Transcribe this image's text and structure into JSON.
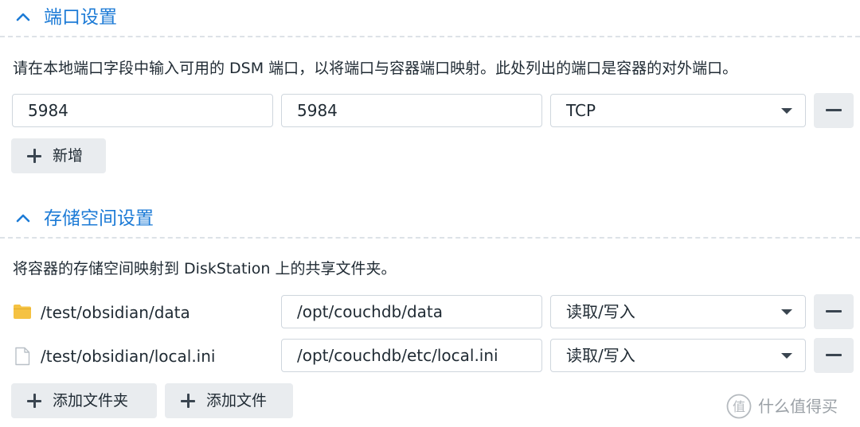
{
  "port_section": {
    "title": "端口设置",
    "description": "请在本地端口字段中输入可用的 DSM 端口，以将端口与容器端口映射。此处列出的端口是容器的对外端口。",
    "rows": [
      {
        "local_port": "5984",
        "container_port": "5984",
        "protocol": "TCP"
      }
    ],
    "add_label": "新增"
  },
  "storage_section": {
    "title": "存储空间设置",
    "description": "将容器的存储空间映射到 DiskStation 上的共享文件夹。",
    "rows": [
      {
        "icon": "folder-icon",
        "host_path": "/test/obsidian/data",
        "mount_path": "/opt/couchdb/data",
        "permission": "读取/写入"
      },
      {
        "icon": "file-icon",
        "host_path": "/test/obsidian/local.ini",
        "mount_path": "/opt/couchdb/etc/local.ini",
        "permission": "读取/写入"
      }
    ],
    "add_folder_label": "添加文件夹",
    "add_file_label": "添加文件"
  },
  "watermark": {
    "text": "什么值得买",
    "icon": "watermark-logo-icon"
  },
  "colors": {
    "accent": "#1d7bd6",
    "button_bg": "#e9ecef",
    "border": "#cfd6dd",
    "folder": "#f5c242"
  }
}
